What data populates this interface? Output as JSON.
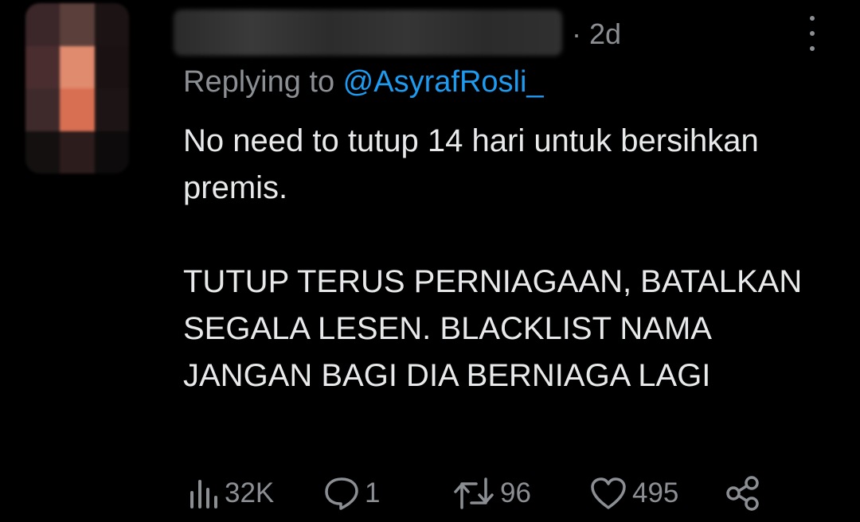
{
  "tweet": {
    "timestamp": "· 2d",
    "replying_prefix": "Replying to ",
    "replying_handle": "@AsyrafRosli_",
    "paragraphs": [
      "No need to tutup 14 hari untuk bersihkan premis.",
      "TUTUP TERUS PERNIAGAAN, BATALKAN SEGALA LESEN. BLACKLIST NAMA JANGAN BAGI DIA BERNIAGA LAGI"
    ]
  },
  "actions": {
    "views": "32K",
    "replies": "1",
    "retweets": "96",
    "likes": "495"
  },
  "icons": {
    "views": "analytics-icon",
    "replies": "reply-icon",
    "retweets": "retweet-icon",
    "likes": "heart-icon",
    "share": "share-icon",
    "more": "more-vertical-icon"
  },
  "colors": {
    "background": "#000000",
    "text": "#e7e9ea",
    "muted": "#8b8f94",
    "link": "#1d9bf0"
  }
}
